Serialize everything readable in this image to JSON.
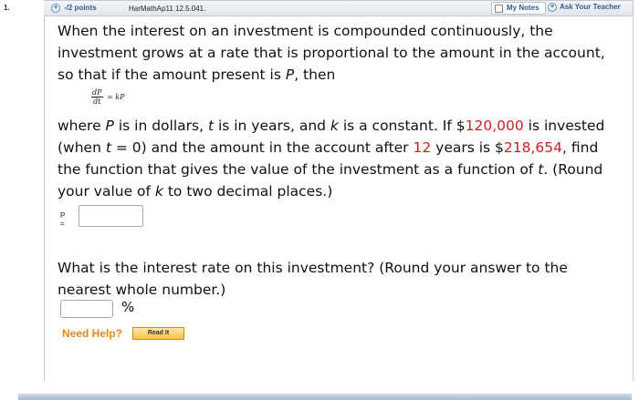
{
  "question": {
    "number": "1.",
    "points": "-/2 points",
    "source": "HarMathAp11 12.5.041.",
    "my_notes": "My Notes",
    "ask_teacher": "Ask Your Teacher"
  },
  "body": {
    "intro_1": "When the interest on an investment is compounded continuously, the investment grows at a rate that is proportional to the amount in the account, so that if the amount present is ",
    "intro_var": "P",
    "intro_2": ", then",
    "formula_num": "dP",
    "formula_den": "dt",
    "formula_rhs": "= kP",
    "p2_a": "where ",
    "p2_P": "P",
    "p2_b": " is in dollars, ",
    "p2_t": "t",
    "p2_c": " is in years, and ",
    "p2_k": "k",
    "p2_d": " is a constant. If $",
    "p2_amount1": "120,000",
    "p2_e": " is invested (when ",
    "p2_t2": "t",
    "p2_f": " = 0) and the amount in the account after ",
    "p2_years": "12",
    "p2_g": " years is $",
    "p2_amount2": "218,654",
    "p2_h": ", find the function that gives the value of the investment as a function of ",
    "p2_t3": "t",
    "p2_i": ". (Round your value of ",
    "p2_k2": "k",
    "p2_j": " to two decimal places.)",
    "p_label": "P =",
    "p_value": "",
    "q2": "What is the interest rate on this investment? (Round your answer to the nearest whole number.)",
    "rate_value": "",
    "percent": "%"
  },
  "help": {
    "label": "Need Help?",
    "read_it": "Read It"
  },
  "colors": {
    "highlight_red": "#cc2222",
    "help_orange": "#e28a18",
    "link_blue": "#2d5d94"
  }
}
